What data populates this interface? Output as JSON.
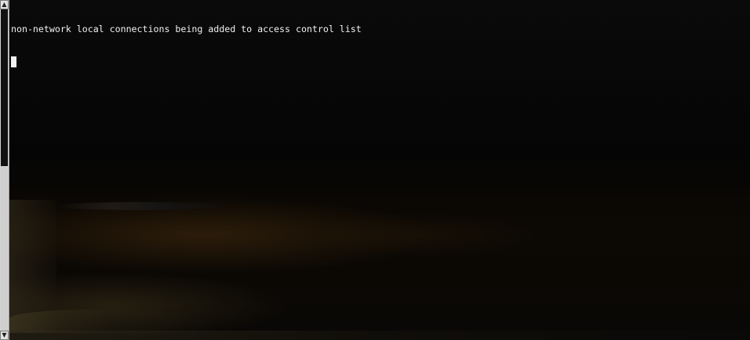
{
  "terminal": {
    "lines": [
      "non-network local connections being added to access control list"
    ],
    "colors": {
      "foreground": "#f0f0f0",
      "background": "#000000",
      "scrollbar": "#d4d4d4"
    }
  },
  "scrollbar": {
    "up_icon": "triangle-up",
    "down_icon": "triangle-down",
    "up_glyph": "▲",
    "down_glyph": "▼"
  }
}
